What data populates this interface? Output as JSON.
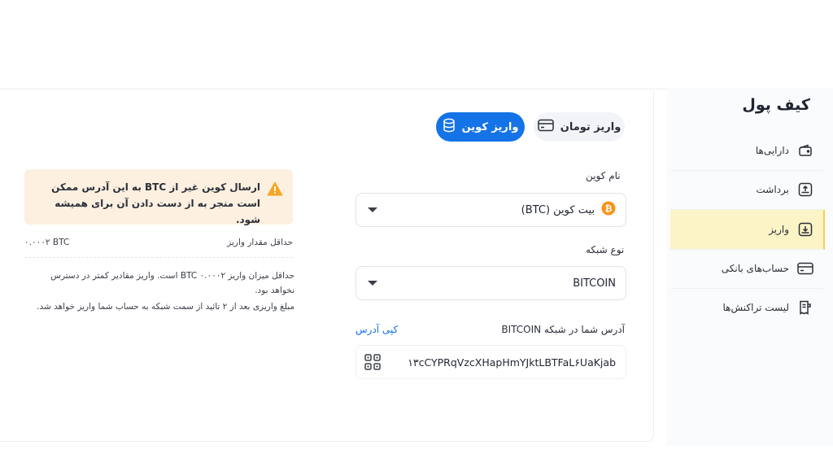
{
  "sidebar": {
    "title": "کیف پول",
    "items": [
      {
        "label": "دارایی‌ها",
        "icon": "wallet-icon"
      },
      {
        "label": "برداشت",
        "icon": "upload-tray-icon"
      },
      {
        "label": "واریز",
        "icon": "download-tray-icon",
        "active": true
      },
      {
        "label": "حساب‌های بانکی",
        "icon": "card-icon"
      },
      {
        "label": "لیست تراکنش‌ها",
        "icon": "receipt-icon"
      }
    ]
  },
  "tabs": {
    "coin_label": "واریز کوین",
    "toman_label": "واریز تومان"
  },
  "form": {
    "coin_label": "نام کوین",
    "coin_value": "بیت کوین (BTC)",
    "network_label": "نوع شبکه",
    "network_value": "BITCOIN",
    "address_label": "آدرس شما در شبکه BITCOIN",
    "copy_label": "کپی آدرس",
    "address_value": "۱۳cCYPRqVzcXHapHmYJktLBTFaL۶UaKjab"
  },
  "info": {
    "warning_text": "ارسال کوین غیر از BTC به این آدرس ممکن است منجر به از دست دادن آن برای همیشه شود.",
    "min_label": "حداقل مقدار واریز",
    "min_value": "۰.۰۰۰۲ BTC",
    "note_1": "حداقل میزان واریز BTC ۰.۰۰۰۲ است. واریز مقادیر کمتر در دسترس نخواهد بود.",
    "note_2": "مبلغ واریزی بعد از ۲ تائید از سمت شبکه به حساب شما واریز خواهد شد."
  },
  "colors": {
    "accent": "#1473e6",
    "active_bg": "#fbf4c6",
    "warning_bg": "#fdf0e1",
    "warning_icon": "#f5a623",
    "btc": "#f7931a"
  }
}
